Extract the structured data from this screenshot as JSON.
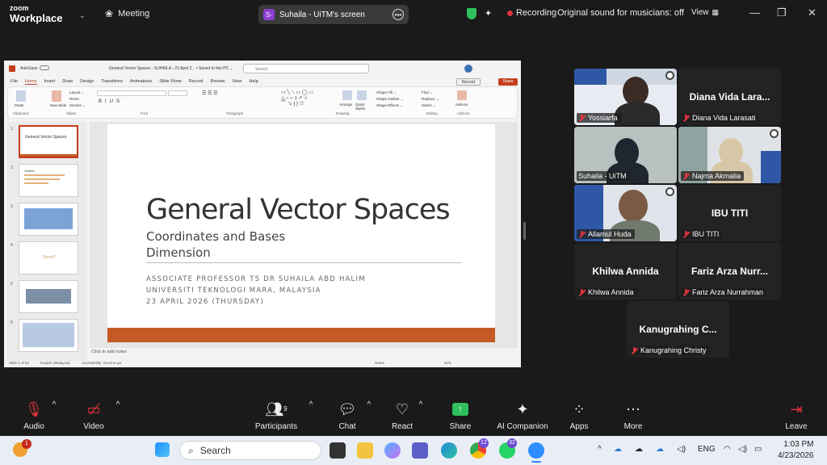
{
  "topbar": {
    "logo_line1": "zoom",
    "logo_line2": "Workplace",
    "meeting_label": "Meeting",
    "share_initial": "S-",
    "share_title": "Suhaila - UiTM's screen",
    "recording_label": "Recording",
    "original_sound": "Original sound for musicians: off",
    "view_label": "View"
  },
  "ppt": {
    "autosave": "AutoSave",
    "window_title": "General Vector Spaces - SUHAILA - 23 April 2... • Saved to this PC ⌄",
    "search_placeholder": "Search",
    "menu": [
      "File",
      "Home",
      "Insert",
      "Draw",
      "Design",
      "Transitions",
      "Animations",
      "Slide Show",
      "Record",
      "Review",
      "View",
      "Help"
    ],
    "record_label": "Record",
    "share_label": "Share",
    "ribbon_groups": [
      "Clipboard",
      "Slides",
      "Font",
      "Paragraph",
      "Drawing",
      "Editing",
      "Add-ins"
    ],
    "ribbon_buttons": {
      "paste": "Paste",
      "new_slide": "New Slide",
      "layout": "Layout ⌄",
      "reset": "Reset",
      "section": "Section ⌄",
      "arrange": "Arrange",
      "quick_styles": "Quick Styles",
      "shape_fill": "Shape Fill ⌄",
      "shape_outline": "Shape Outline ⌄",
      "shape_effects": "Shape Effects ⌄",
      "find": "Find ⌄",
      "replace": "Replace ⌄",
      "select": "Select ⌄",
      "addins": "Add-ins"
    },
    "thumb_numbers": [
      "1",
      "2",
      "3",
      "4",
      "5",
      "6"
    ],
    "thumb1_title": "General Vector Spaces",
    "thumb2_title": "Outline",
    "thumb4_text": "Basis?",
    "slide": {
      "title": "General Vector Spaces",
      "subtitle1": "Coordinates and Bases",
      "subtitle2": "Dimension",
      "meta1": "ASSOCIATE PROFESSOR TS DR SUHAILA ABD HALIM",
      "meta2": "UNIVERSITI TEKNOLOGI MARA, MALAYSIA",
      "meta3": "23 APRIL 2026 (THURSDAY)"
    },
    "notes_placeholder": "Click to add notes",
    "status": [
      "Slide 1 of 53",
      "English (Malaysia)",
      "Accessibility: Good to go",
      "Notes",
      "52%"
    ]
  },
  "participants": [
    {
      "big": "",
      "label": "Yossiarfa",
      "video": true
    },
    {
      "big": "Diana Vida Lara...",
      "label": "Diana Vida Larasati",
      "video": false
    },
    {
      "big": "",
      "label": "Suhaila - UiTM",
      "video": true
    },
    {
      "big": "",
      "label": "Najma Akmalia",
      "video": true
    },
    {
      "big": "",
      "label": "Allamul Huda",
      "video": true
    },
    {
      "big": "IBU TITI",
      "label": "IBU TITI",
      "video": false
    },
    {
      "big": "Khilwa Annida",
      "label": "Khilwa Annida",
      "video": false
    },
    {
      "big": "Fariz Arza Nurr...",
      "label": "Fariz Arza Nurrahman",
      "video": false
    },
    {
      "big": "Kanugrahing C...",
      "label": "Kanugrahing Christy",
      "video": false
    }
  ],
  "controls": {
    "audio": "Audio",
    "video": "Video",
    "participants": "Participants",
    "participants_count": "9",
    "chat": "Chat",
    "react": "React",
    "share": "Share",
    "ai_companion": "AI Companion",
    "apps": "Apps",
    "more": "More",
    "leave": "Leave"
  },
  "taskbar": {
    "search": "Search",
    "notif_badge": "1",
    "chrome_badge": "12",
    "whatsapp_badge": "32",
    "lang": "ENG",
    "time": "1:03 PM",
    "date": "4/23/2026"
  },
  "colors": {
    "recording": "#e0333c",
    "shield": "#2fbf5b",
    "share_green": "#2fbf5b",
    "slide_bar": "#c55a27",
    "ppt_accent": "#c43e1c"
  }
}
